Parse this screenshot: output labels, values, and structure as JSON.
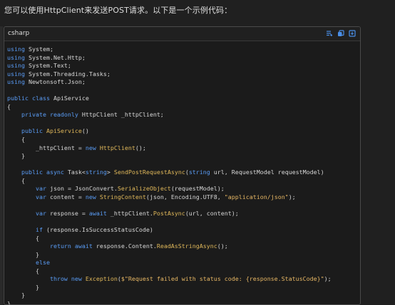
{
  "intro_text": "您可以使用HttpClient来发送POST请求。以下是一个示例代码：",
  "code_block": {
    "language": "csharp",
    "actions": [
      "edit-icon",
      "copy-icon",
      "download-icon"
    ],
    "accent_color": "#5a9cf5",
    "lines": [
      [
        [
          "kw",
          "using"
        ],
        [
          "plain",
          " System;"
        ]
      ],
      [
        [
          "kw",
          "using"
        ],
        [
          "plain",
          " System.Net.Http;"
        ]
      ],
      [
        [
          "kw",
          "using"
        ],
        [
          "plain",
          " System.Text;"
        ]
      ],
      [
        [
          "kw",
          "using"
        ],
        [
          "plain",
          " System.Threading.Tasks;"
        ]
      ],
      [
        [
          "kw",
          "using"
        ],
        [
          "plain",
          " Newtonsoft.Json;"
        ]
      ],
      [
        [
          "plain",
          ""
        ]
      ],
      [
        [
          "kw",
          "public class"
        ],
        [
          "plain",
          " ApiService"
        ]
      ],
      [
        [
          "plain",
          "{"
        ]
      ],
      [
        [
          "plain",
          "    "
        ],
        [
          "kw",
          "private readonly"
        ],
        [
          "plain",
          " HttpClient _httpClient;"
        ]
      ],
      [
        [
          "plain",
          ""
        ]
      ],
      [
        [
          "plain",
          "    "
        ],
        [
          "kw",
          "public"
        ],
        [
          "plain",
          " "
        ],
        [
          "fn",
          "ApiService"
        ],
        [
          "plain",
          "()"
        ]
      ],
      [
        [
          "plain",
          "    {"
        ]
      ],
      [
        [
          "plain",
          "        _httpClient = "
        ],
        [
          "kw",
          "new"
        ],
        [
          "plain",
          " "
        ],
        [
          "fn",
          "HttpClient"
        ],
        [
          "plain",
          "();"
        ]
      ],
      [
        [
          "plain",
          "    }"
        ]
      ],
      [
        [
          "plain",
          ""
        ]
      ],
      [
        [
          "plain",
          "    "
        ],
        [
          "kw",
          "public async"
        ],
        [
          "plain",
          " Task<"
        ],
        [
          "kw",
          "string"
        ],
        [
          "plain",
          "> "
        ],
        [
          "fn",
          "SendPostRequestAsync"
        ],
        [
          "plain",
          "("
        ],
        [
          "kw",
          "string"
        ],
        [
          "plain",
          " url, RequestModel requestModel)"
        ]
      ],
      [
        [
          "plain",
          "    {"
        ]
      ],
      [
        [
          "plain",
          "        "
        ],
        [
          "kw",
          "var"
        ],
        [
          "plain",
          " json = JsonConvert."
        ],
        [
          "fn",
          "SerializeObject"
        ],
        [
          "plain",
          "(requestModel);"
        ]
      ],
      [
        [
          "plain",
          "        "
        ],
        [
          "kw",
          "var"
        ],
        [
          "plain",
          " content = "
        ],
        [
          "kw",
          "new"
        ],
        [
          "plain",
          " "
        ],
        [
          "fn",
          "StringContent"
        ],
        [
          "plain",
          "(json, Encoding.UTF8, "
        ],
        [
          "str",
          "\"application/json\""
        ],
        [
          "plain",
          ");"
        ]
      ],
      [
        [
          "plain",
          ""
        ]
      ],
      [
        [
          "plain",
          "        "
        ],
        [
          "kw",
          "var"
        ],
        [
          "plain",
          " response = "
        ],
        [
          "kw",
          "await"
        ],
        [
          "plain",
          " _httpClient."
        ],
        [
          "fn",
          "PostAsync"
        ],
        [
          "plain",
          "(url, content);"
        ]
      ],
      [
        [
          "plain",
          ""
        ]
      ],
      [
        [
          "plain",
          "        "
        ],
        [
          "kw",
          "if"
        ],
        [
          "plain",
          " (response.IsSuccessStatusCode)"
        ]
      ],
      [
        [
          "plain",
          "        {"
        ]
      ],
      [
        [
          "plain",
          "            "
        ],
        [
          "kw",
          "return await"
        ],
        [
          "plain",
          " response.Content."
        ],
        [
          "fn",
          "ReadAsStringAsync"
        ],
        [
          "plain",
          "();"
        ]
      ],
      [
        [
          "plain",
          "        }"
        ]
      ],
      [
        [
          "plain",
          "        "
        ],
        [
          "kw",
          "else"
        ]
      ],
      [
        [
          "plain",
          "        {"
        ]
      ],
      [
        [
          "plain",
          "            "
        ],
        [
          "kw",
          "throw new"
        ],
        [
          "plain",
          " "
        ],
        [
          "fn",
          "Exception"
        ],
        [
          "plain",
          "("
        ],
        [
          "str",
          "$\"Request failed with status code: {response.StatusCode}\""
        ],
        [
          "plain",
          ");"
        ]
      ],
      [
        [
          "plain",
          "        }"
        ]
      ],
      [
        [
          "plain",
          "    }"
        ]
      ],
      [
        [
          "plain",
          "}"
        ]
      ]
    ]
  }
}
